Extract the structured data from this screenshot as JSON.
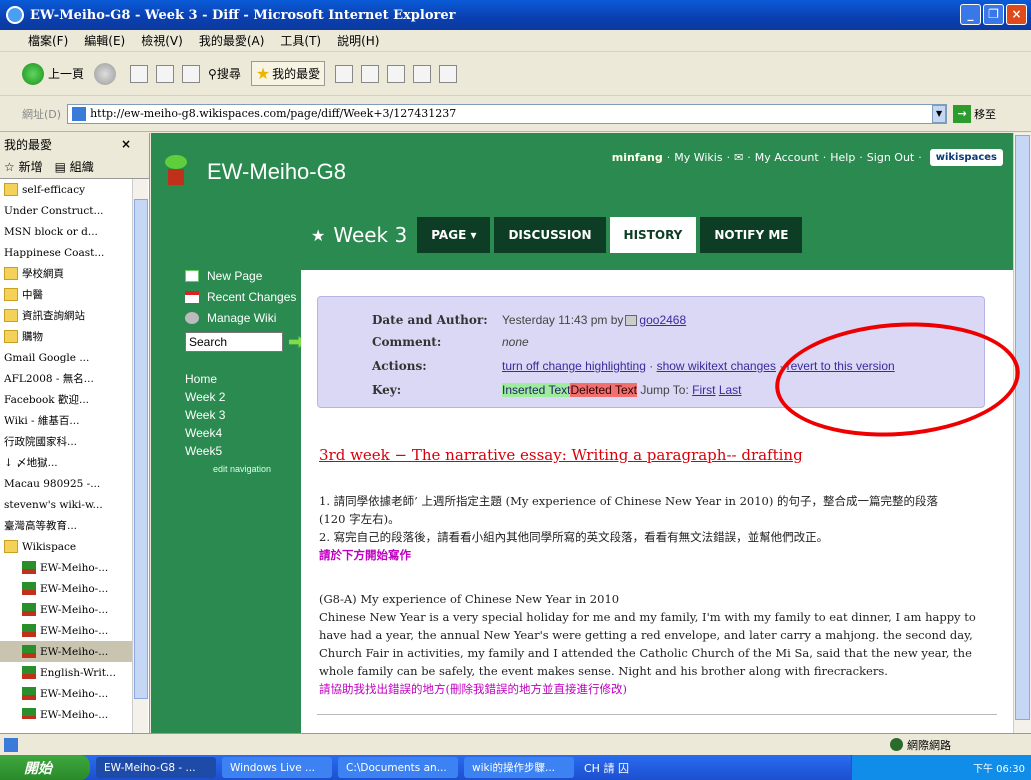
{
  "window": {
    "title": "EW-Meiho-G8 - Week 3 - Diff - Microsoft Internet Explorer"
  },
  "menu": [
    "檔案(F)",
    "編輯(E)",
    "檢視(V)",
    "我的最愛(A)",
    "工具(T)",
    "說明(H)"
  ],
  "toolbar": {
    "back": "上一頁",
    "search": "搜尋",
    "favorites": "我的最愛"
  },
  "address": {
    "label": "網址(D)",
    "url": "http://ew-meiho-g8.wikispaces.com/page/diff/Week+3/127431237",
    "go": "移至"
  },
  "favorites_pane": {
    "title": "我的最愛",
    "close": "×",
    "add": "新增",
    "organize": "組織",
    "items": [
      {
        "label": "self-efficacy",
        "icon": "folder"
      },
      {
        "label": "Under Construct...",
        "icon": "page"
      },
      {
        "label": "MSN block or d...",
        "icon": "page"
      },
      {
        "label": "Happinese Coast...",
        "icon": "page"
      },
      {
        "label": "學校網頁",
        "icon": "folder"
      },
      {
        "label": "中醫",
        "icon": "folder"
      },
      {
        "label": "資訊查詢網站",
        "icon": "folder"
      },
      {
        "label": "購物",
        "icon": "folder"
      },
      {
        "label": "Gmail Google ...",
        "icon": "page"
      },
      {
        "label": "AFL2008 - 無名...",
        "icon": "page"
      },
      {
        "label": "Facebook 歡迎...",
        "icon": "page"
      },
      {
        "label": "Wiki - 維基百...",
        "icon": "page"
      },
      {
        "label": "行政院國家科...",
        "icon": "page"
      },
      {
        "label": "↓ 〆地獄...",
        "icon": "page"
      },
      {
        "label": "Macau 980925 -...",
        "icon": "page"
      },
      {
        "label": "stevenw's wiki-w...",
        "icon": "page"
      },
      {
        "label": "臺灣高等教育...",
        "icon": "page"
      },
      {
        "label": "Wikispace",
        "icon": "folder"
      },
      {
        "label": "EW-Meiho-...",
        "icon": "plant",
        "sub": true
      },
      {
        "label": "EW-Meiho-...",
        "icon": "plant",
        "sub": true
      },
      {
        "label": "EW-Meiho-...",
        "icon": "plant",
        "sub": true
      },
      {
        "label": "EW-Meiho-...",
        "icon": "plant",
        "sub": true
      },
      {
        "label": "EW-Meiho-...",
        "icon": "plant",
        "sub": true,
        "selected": true
      },
      {
        "label": "English-Writ...",
        "icon": "plant",
        "sub": true
      },
      {
        "label": "EW-Meiho-...",
        "icon": "plant",
        "sub": true
      },
      {
        "label": "EW-Meiho-...",
        "icon": "plant",
        "sub": true
      },
      {
        "label": "EW-Meiho-...",
        "icon": "plant",
        "sub": true
      }
    ]
  },
  "wiki": {
    "user": "minfang",
    "my_wikis": "My Wikis",
    "my_account": "My Account",
    "help": "Help",
    "sign_out": "Sign Out",
    "logo": "wikispaces",
    "site_title": "EW-Meiho-G8",
    "page_name": "Week 3",
    "tabs": [
      "PAGE ▾",
      "DISCUSSION",
      "HISTORY",
      "NOTIFY ME"
    ],
    "active_tab": "HISTORY",
    "nav": {
      "new_page": "New Page",
      "recent_changes": "Recent Changes",
      "manage_wiki": "Manage Wiki",
      "search_value": "Search",
      "links": [
        "Home",
        "Week 2",
        "Week 3",
        "Week4",
        "Week5"
      ],
      "edit_nav": "edit navigation"
    },
    "diff": {
      "date_label": "Date and Author:",
      "date_value": "Yesterday 11:43 pm by",
      "author": "goo2468",
      "comment_label": "Comment:",
      "comment_value": "none",
      "actions_label": "Actions:",
      "action1": "turn off change highlighting",
      "action2": "show wikitext changes",
      "action3": "revert to this version",
      "key_label": "Key:",
      "inserted": "Inserted Text",
      "deleted": "Deleted Text",
      "jump": "Jump To:",
      "first": "First",
      "last": "Last"
    },
    "heading": "3rd week − The narrative essay: Writing a paragraph-- drafting",
    "instructions": {
      "line1": "1. 請同學依據老師’ 上週所指定主題 (My experience of Chinese New Year in 2010) 的句子，整合成一篇完整的段落",
      "line1b": "(120 字左右)。",
      "line2": "2. 寫完自己的段落後，請看看小組內其他同學所寫的英文段落，看看有無文法錯誤，並幫他們改正。",
      "line3": "請於下方開始寫作"
    },
    "essay": {
      "title": "(G8-A) My experience of Chinese New Year in 2010",
      "body": "Chinese New Year is a very special holiday for me and my family, I'm with my family to eat dinner, I am happy to have had a year, the annual New Year's were getting a red envelope, and later carry a mahjong. the second day, Church Fair in activities, my family and I attended the Catholic Church of the Mi Sa, said that the new year, the whole family can be safely, the event makes sense. Night and his brother along with firecrackers.",
      "note": "請協助我找出錯誤的地方(刪除我錯誤的地方並直接進行修改)"
    }
  },
  "status": {
    "zone": "網際網路"
  },
  "taskbar": {
    "start": "開始",
    "tasks": [
      "EW-Meiho-G8 - ...",
      "Windows Live ...",
      "C:\\Documents an...",
      "wiki的操作步驟..."
    ],
    "lang": "CH 請 囚",
    "clock": "下午 06:30"
  }
}
